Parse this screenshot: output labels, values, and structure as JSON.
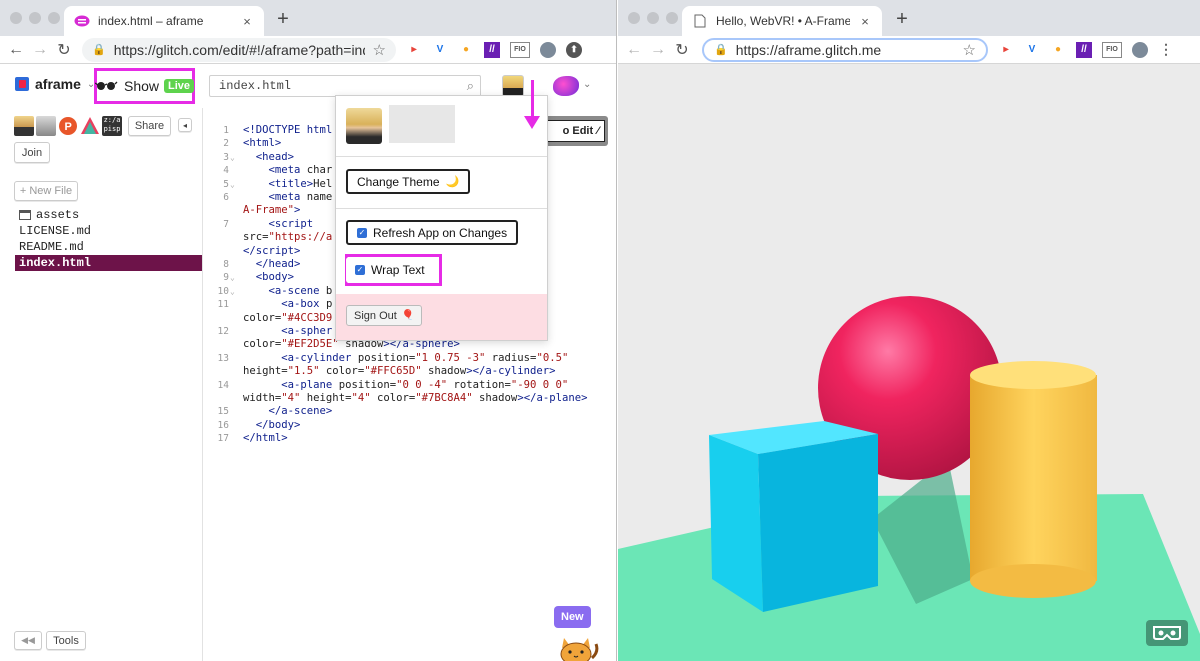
{
  "left_window": {
    "tab": {
      "title": "index.html – aframe",
      "close": "×",
      "new_tab": "+"
    },
    "address": {
      "url": "https://glitch.com/edit/#!/aframe?path=index..."
    },
    "extensions": [
      "▸",
      "V",
      "●",
      "//",
      "FIO"
    ]
  },
  "glitch": {
    "project_name": "aframe",
    "show_label": "Show",
    "live_badge": "Live",
    "file_search_value": "index.html",
    "share_label": "Share",
    "join_label": "Join",
    "new_file_label": "+ New File",
    "files": [
      {
        "name": "assets",
        "type": "folder"
      },
      {
        "name": "LICENSE.md",
        "type": "file"
      },
      {
        "name": "README.md",
        "type": "file"
      },
      {
        "name": "index.html",
        "type": "file",
        "active": true
      }
    ],
    "tools_label": "Tools",
    "edit_label": "o Edit",
    "new_badge": "New"
  },
  "code": {
    "lines": [
      {
        "n": "1",
        "fold": "",
        "html": "<span class=\"tag\">&lt;!DOCTYPE html</span>"
      },
      {
        "n": "2",
        "fold": "",
        "html": "<span class=\"tag\">&lt;html&gt;</span>"
      },
      {
        "n": "3",
        "fold": "⌄",
        "html": "  <span class=\"tag\">&lt;head&gt;</span>"
      },
      {
        "n": "4",
        "fold": "",
        "html": "    <span class=\"tag\">&lt;meta</span> <span class=\"att\">char</span>"
      },
      {
        "n": "5",
        "fold": "⌄",
        "html": "    <span class=\"tag\">&lt;title&gt;</span>Hel"
      },
      {
        "n": "6",
        "fold": "",
        "html": "    <span class=\"tag\">&lt;meta</span> <span class=\"att\">name</span>                      <span class=\"str\">ebVR! •</span>"
      },
      {
        "n": "",
        "fold": "",
        "html": "<span class=\"str\">A-Frame\"</span><span class=\"tag\">&gt;</span>"
      },
      {
        "n": "7",
        "fold": "",
        "html": "    <span class=\"tag\">&lt;script</span>"
      },
      {
        "n": "",
        "fold": "",
        "html": "src=<span class=\"str\">\"https://a</span>                       <span class=\"str\">in.js\"</span><span class=\"tag\">&gt;</span>"
      },
      {
        "n": "",
        "fold": "",
        "html": "<span class=\"tag\">&lt;/script&gt;</span>"
      },
      {
        "n": "8",
        "fold": "",
        "html": "  <span class=\"tag\">&lt;/head&gt;</span>"
      },
      {
        "n": "9",
        "fold": "⌄",
        "html": "  <span class=\"tag\">&lt;body&gt;</span>"
      },
      {
        "n": "10",
        "fold": "⌄",
        "html": "    <span class=\"tag\">&lt;a-scene</span> b"
      },
      {
        "n": "11",
        "fold": "",
        "html": "      <span class=\"tag\">&lt;a-box</span> p                        <span class=\"str\">45 0\"</span>"
      },
      {
        "n": "",
        "fold": "",
        "html": "color=<span class=\"str\">\"#4CC3D9</span>"
      },
      {
        "n": "12",
        "fold": "",
        "html": "      <span class=\"tag\">&lt;a-spher</span>                        <span class=\"str\">.25\"</span>"
      },
      {
        "n": "",
        "fold": "",
        "html": "color=<span class=\"str\">\"#EF2D5E\"</span> shadow<span class=\"tag\">&gt;&lt;/a-sphere&gt;</span>"
      },
      {
        "n": "13",
        "fold": "",
        "html": "      <span class=\"tag\">&lt;a-cylinder</span> position=<span class=\"str\">\"1 0.75 -3\"</span> radius=<span class=\"str\">\"0.5\"</span>"
      },
      {
        "n": "",
        "fold": "",
        "html": "height=<span class=\"str\">\"1.5\"</span> color=<span class=\"str\">\"#FFC65D\"</span> shadow<span class=\"tag\">&gt;&lt;/a-cylinder&gt;</span>"
      },
      {
        "n": "14",
        "fold": "",
        "html": "      <span class=\"tag\">&lt;a-plane</span> position=<span class=\"str\">\"0 0 -4\"</span> rotation=<span class=\"str\">\"-90 0 0\"</span>"
      },
      {
        "n": "",
        "fold": "",
        "html": "width=<span class=\"str\">\"4\"</span> height=<span class=\"str\">\"4\"</span> color=<span class=\"str\">\"#7BC8A4\"</span> shadow<span class=\"tag\">&gt;&lt;/a-plane&gt;</span>"
      },
      {
        "n": "15",
        "fold": "",
        "html": "    <span class=\"tag\">&lt;/a-scene&gt;</span>"
      },
      {
        "n": "16",
        "fold": "",
        "html": "  <span class=\"tag\">&lt;/body&gt;</span>"
      },
      {
        "n": "17",
        "fold": "",
        "html": "<span class=\"tag\">&lt;/html&gt;</span>"
      }
    ]
  },
  "menu": {
    "change_theme": "Change Theme",
    "theme_icon": "🌙",
    "refresh_app": "Refresh App on Changes",
    "refresh_checked": true,
    "wrap_text": "Wrap Text",
    "wrap_checked": true,
    "sign_out": "Sign Out",
    "sign_out_icon": "🎈"
  },
  "right_window": {
    "tab": {
      "title": "Hello, WebVR! • A-Frame",
      "close": "×",
      "new_tab": "+"
    },
    "address": {
      "url": "https://aframe.glitch.me"
    },
    "extensions": [
      "▸",
      "V",
      "●",
      "//",
      "FIO"
    ],
    "scene_colors": {
      "sky": "#ECECEC",
      "plane": "#7BC8A4",
      "box": "#4CC3D9",
      "sphere": "#EF2D5E",
      "cylinder": "#FFC65D"
    }
  },
  "colors": {
    "highlight": "#E62BE6",
    "active_file": "#6D1349",
    "live_badge": "#5ED34D"
  }
}
